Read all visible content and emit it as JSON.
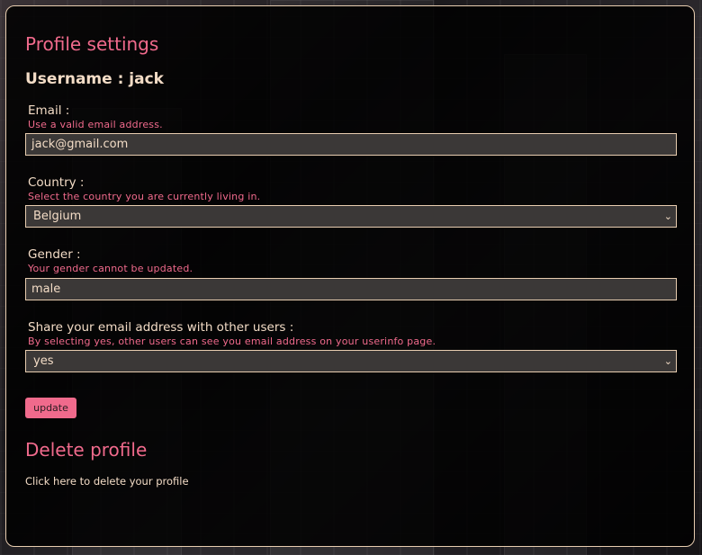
{
  "settings": {
    "title": "Profile settings",
    "username_line": "Username : jack"
  },
  "fields": {
    "email": {
      "label": "Email :",
      "hint": "Use a valid email address.",
      "value": "jack@gmail.com"
    },
    "country": {
      "label": "Country :",
      "hint": "Select the country you are currently living in.",
      "value": "Belgium"
    },
    "gender": {
      "label": "Gender :",
      "hint": "Your gender cannot be updated.",
      "value": "male"
    },
    "share_email": {
      "label": "Share your email address with other users :",
      "hint": "By selecting yes, other users can see you email address on your userinfo page.",
      "value": "yes"
    }
  },
  "actions": {
    "update_label": "update"
  },
  "delete": {
    "title": "Delete profile",
    "link_text": "Click here to delete your profile"
  },
  "icons": {
    "select_chevron": "chevron-down-icon"
  },
  "colors": {
    "accent": "#f06a8c",
    "text": "#f3dcc6",
    "border": "#e8cdb0",
    "input_bg": "#3b3837",
    "panel_bg": "#000000"
  }
}
